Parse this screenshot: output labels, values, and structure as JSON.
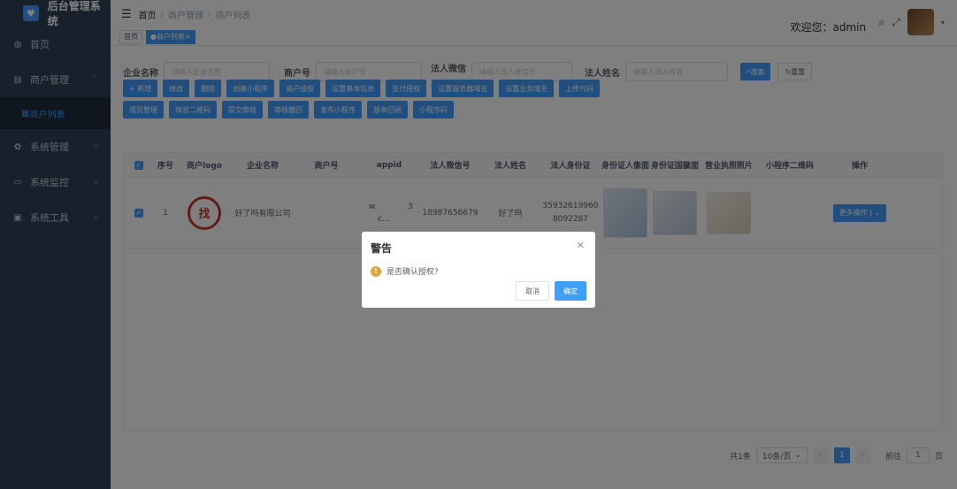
{
  "sidebar": {
    "title": "后台管理系统",
    "items": [
      {
        "label": "首页",
        "icon": "dashboard-icon"
      },
      {
        "label": "商户管理",
        "icon": "shop-icon"
      },
      {
        "label": "商户列表",
        "icon": "grid-icon"
      },
      {
        "label": "系统管理",
        "icon": "gear-icon"
      },
      {
        "label": "系统监控",
        "icon": "monitor-icon"
      },
      {
        "label": "系统工具",
        "icon": "tool-icon"
      }
    ]
  },
  "header": {
    "breadcrumb": [
      "首页",
      "商户管理",
      "商户列表"
    ],
    "welcome": "欢迎您：admin"
  },
  "tags": [
    "首页",
    "商户列表"
  ],
  "search": {
    "company_label": "企业名称",
    "company_ph": "请输入企业名称",
    "merchant_label": "商户号",
    "merchant_ph": "请输入商户号",
    "wechat_label": "法人微信号",
    "wechat_ph": "请输入法人微信号",
    "name_label": "法人姓名",
    "name_ph": "请输入法人姓名",
    "search_btn": "搜索",
    "reset_btn": "重置"
  },
  "toolbar": {
    "row1": [
      "+ 新增",
      "修改",
      "删除",
      "创建小程序",
      "商户授权",
      "设置基本信息",
      "支付授权",
      "设置服务器域名",
      "设置业务域名",
      "上传代码"
    ],
    "row2": [
      "成员管理",
      "体验二维码",
      "提交审核",
      "审核撤回",
      "发布小程序",
      "版本回退",
      "小程序码"
    ]
  },
  "table": {
    "headers": [
      "序号",
      "商户logo",
      "企业名称",
      "商户号",
      "appid",
      "法人微信号",
      "法人姓名",
      "法人身份证",
      "身份证人像面",
      "身份证国徽面",
      "营业执照照片",
      "小程序二维码",
      "操作"
    ],
    "row": {
      "index": "1",
      "company": "好了吗有限公司",
      "merchant_no": "",
      "appid_a": "w.",
      "appid_b": "3",
      "appid_c": "c...",
      "wechat": "18987656679",
      "name": "好了吗",
      "idcard_a": "35932619960",
      "idcard_b": "8092287",
      "action": "更多操作"
    }
  },
  "pager": {
    "total": "共1条",
    "page_size": "10条/页",
    "current": "1",
    "goto_label": "前往",
    "goto_value": "1",
    "goto_unit": "页"
  },
  "dialog": {
    "title": "警告",
    "message": "是否确认授权?",
    "cancel": "取消",
    "confirm": "确定"
  }
}
